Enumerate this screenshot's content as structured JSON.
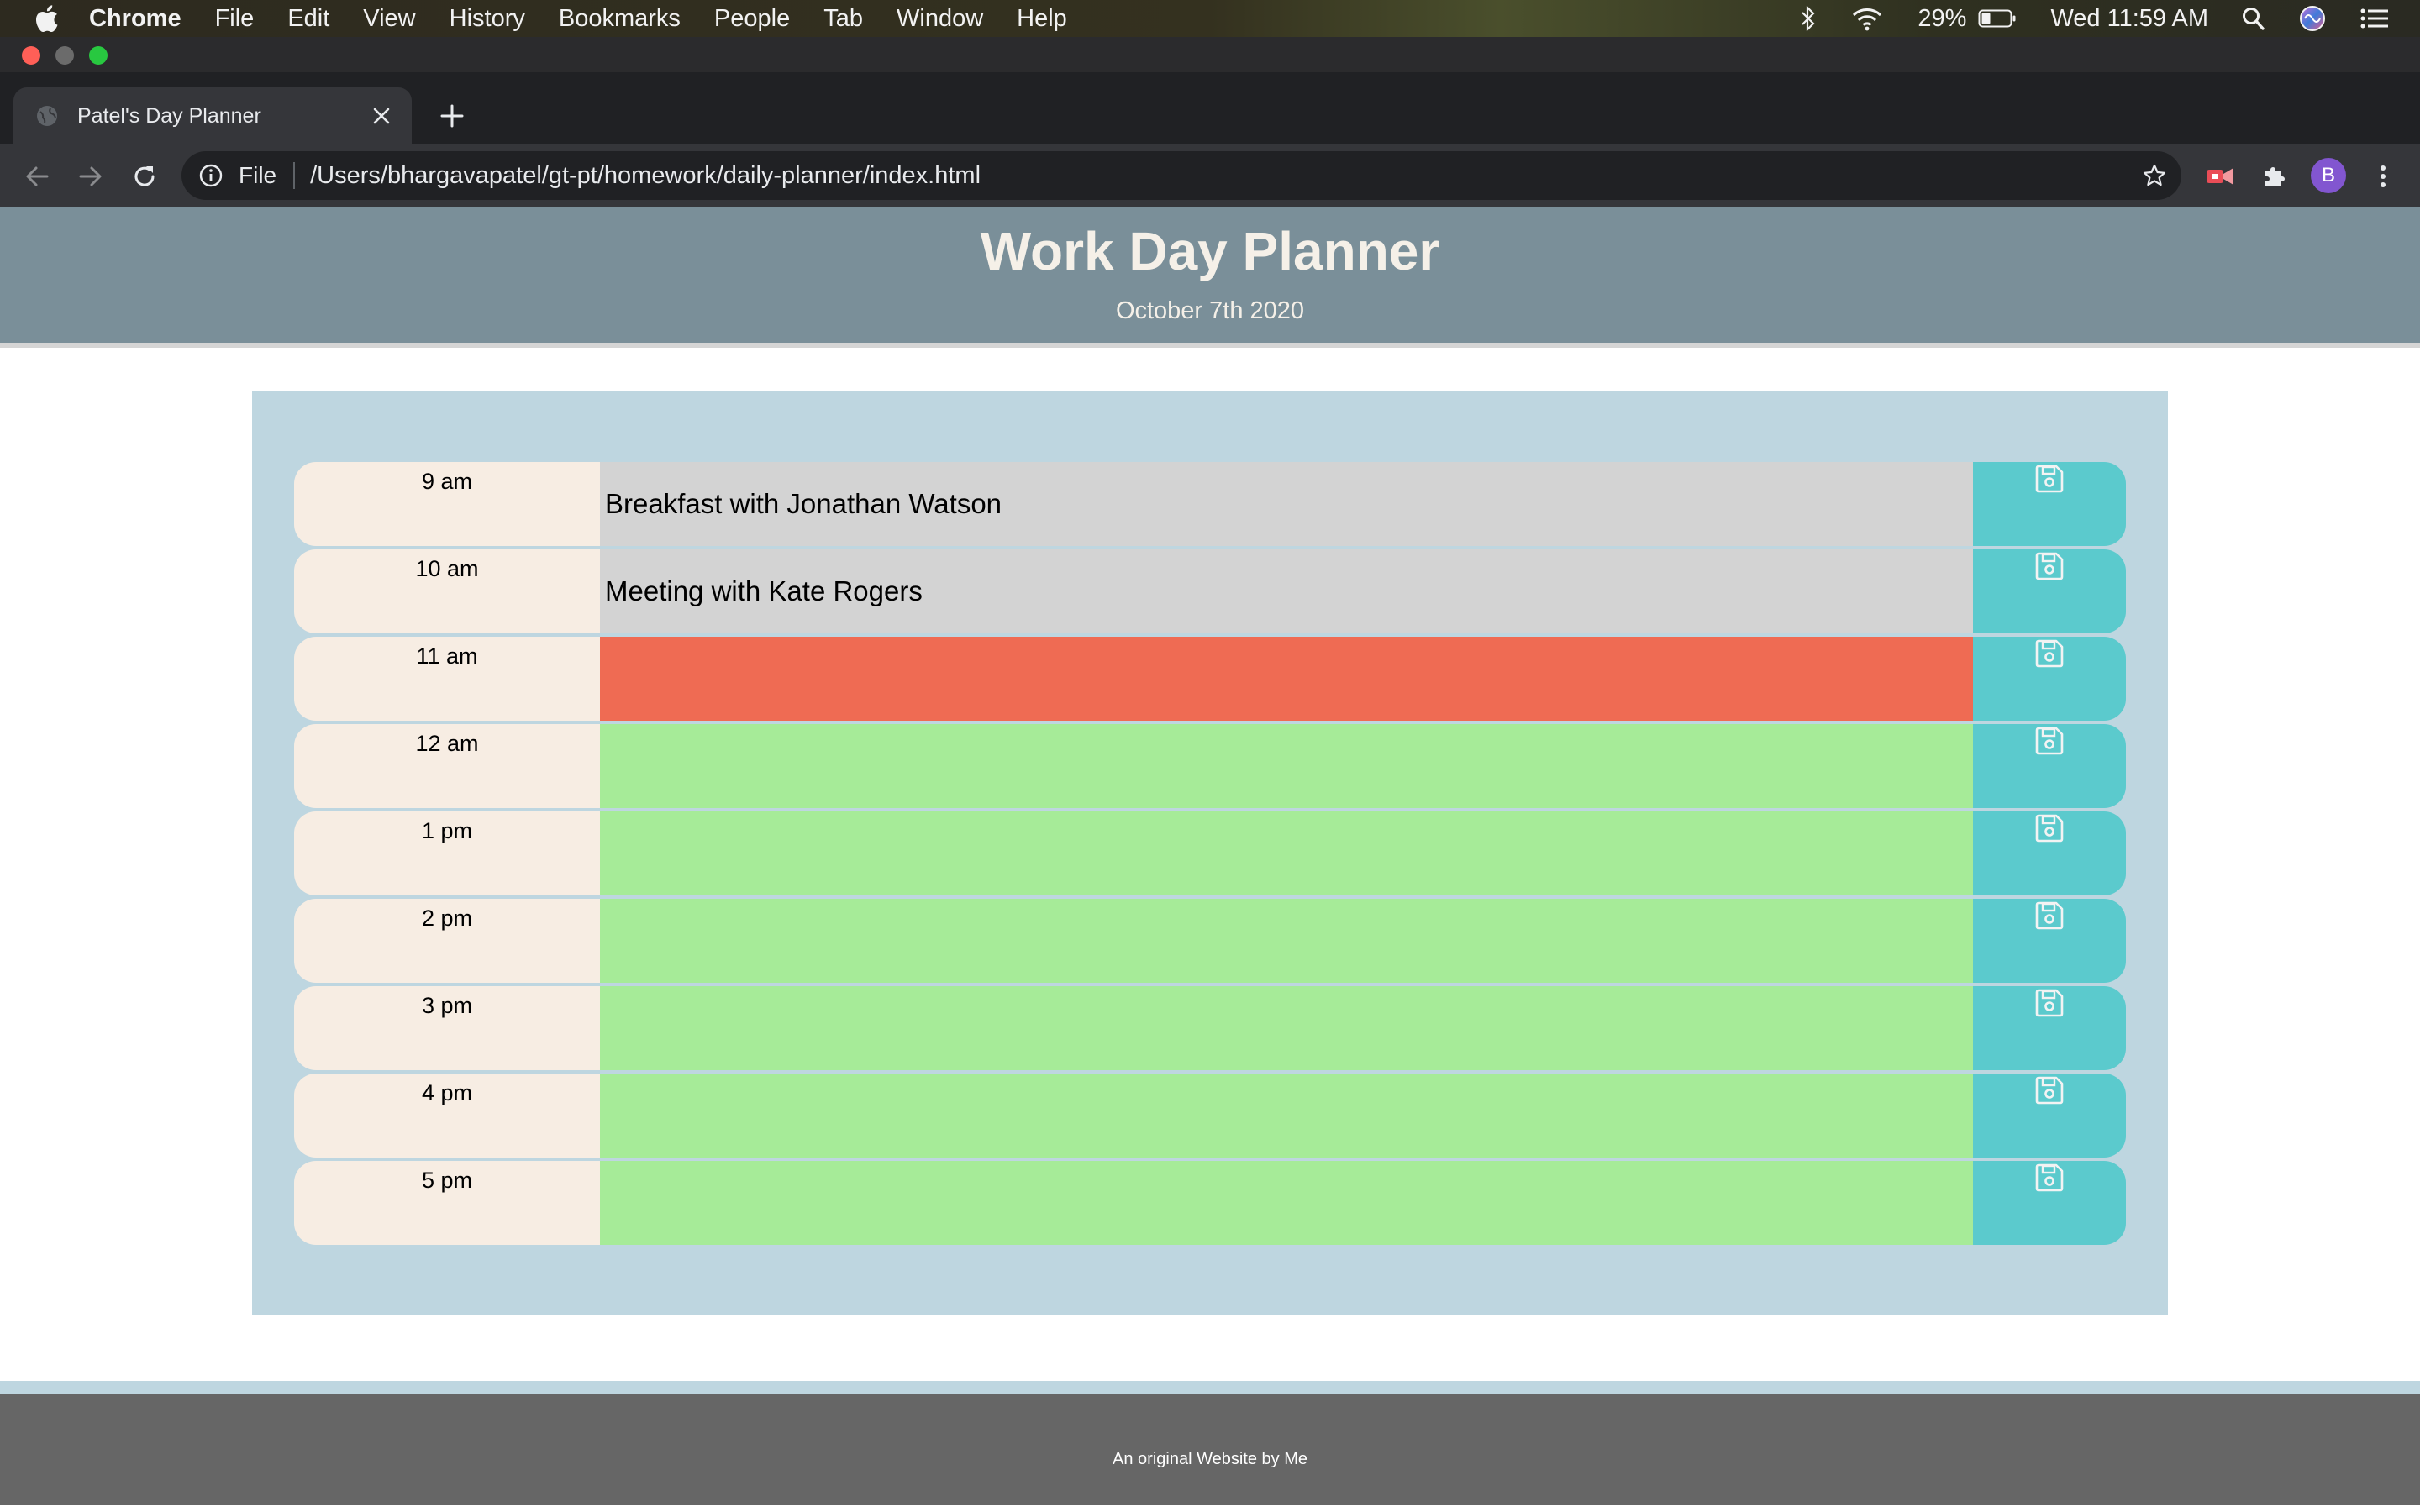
{
  "menubar": {
    "app_name": "Chrome",
    "items": [
      "File",
      "Edit",
      "View",
      "History",
      "Bookmarks",
      "People",
      "Tab",
      "Window",
      "Help"
    ],
    "battery_percent": "29%",
    "clock": "Wed 11:59 AM"
  },
  "browser": {
    "tab_title": "Patel's Day Planner",
    "scheme_label": "File",
    "url": "/Users/bhargavapatel/gt-pt/homework/daily-planner/index.html",
    "profile_initial": "B"
  },
  "page": {
    "title": "Work Day Planner",
    "date": "October 7th 2020",
    "footer": "An original Website by Me"
  },
  "colors": {
    "header_bg": "#7a8f99",
    "container_bg": "#bed6e0",
    "hour_bg": "#f7ede3",
    "past": "#d3d3d3",
    "present": "#ef6b53",
    "future": "#a6eb98",
    "save_button": "#5bcacd",
    "footer_bg": "#666666"
  },
  "timeblocks": [
    {
      "hour": "9 am",
      "text": "Breakfast with Jonathan Watson",
      "state": "past"
    },
    {
      "hour": "10 am",
      "text": "Meeting with Kate Rogers",
      "state": "past"
    },
    {
      "hour": "11 am",
      "text": "",
      "state": "present"
    },
    {
      "hour": "12 am",
      "text": "",
      "state": "future"
    },
    {
      "hour": "1 pm",
      "text": "",
      "state": "future"
    },
    {
      "hour": "2 pm",
      "text": "",
      "state": "future"
    },
    {
      "hour": "3 pm",
      "text": "",
      "state": "future"
    },
    {
      "hour": "4 pm",
      "text": "",
      "state": "future"
    },
    {
      "hour": "5 pm",
      "text": "",
      "state": "future"
    }
  ],
  "icons": {
    "save": "floppy-disk-icon"
  }
}
